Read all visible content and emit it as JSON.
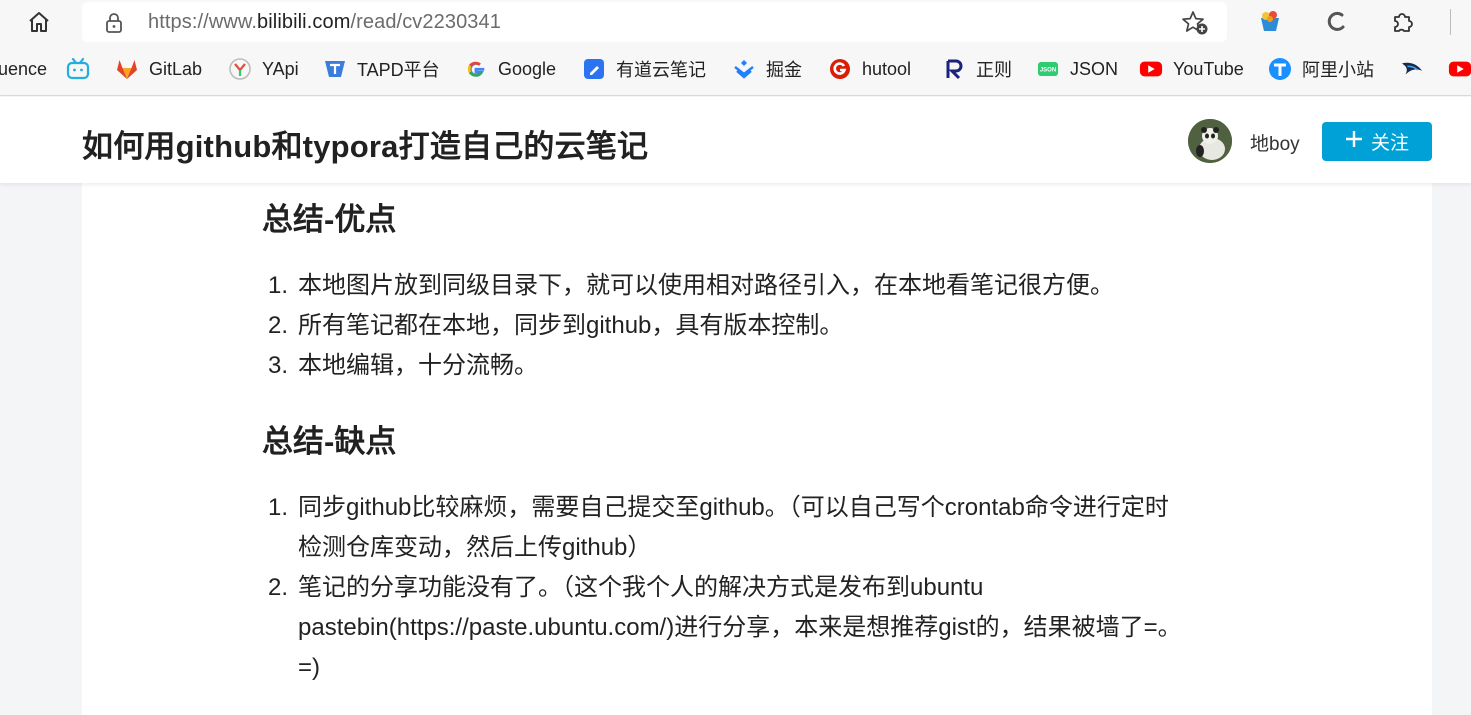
{
  "browser": {
    "url_prefix": "https://www.",
    "url_host": "bilibili.com",
    "url_path": "/read/cv2230341"
  },
  "bookmarks": [
    {
      "label": "uence",
      "icon": "confluence-icon"
    },
    {
      "label": "",
      "icon": "bilibili-tv-icon"
    },
    {
      "label": "GitLab",
      "icon": "gitlab-icon"
    },
    {
      "label": "YApi",
      "icon": "yapi-icon"
    },
    {
      "label": "TAPD平台",
      "icon": "tapd-icon"
    },
    {
      "label": "Google",
      "icon": "google-icon"
    },
    {
      "label": "有道云笔记",
      "icon": "youdao-note-icon"
    },
    {
      "label": "掘金",
      "icon": "juejin-icon"
    },
    {
      "label": "hutool",
      "icon": "hutool-icon"
    },
    {
      "label": "正则",
      "icon": "regex-icon"
    },
    {
      "label": "JSON",
      "icon": "json-icon"
    },
    {
      "label": "YouTube",
      "icon": "youtube-icon"
    },
    {
      "label": "阿里小站",
      "icon": "aliyun-icon"
    },
    {
      "label": "",
      "icon": "bird-icon"
    },
    {
      "label": "",
      "icon": "youtube-icon"
    }
  ],
  "header": {
    "title": "如何用github和typora打造自己的云笔记",
    "author": "地boy",
    "follow_label": "关注"
  },
  "article": {
    "sections": [
      {
        "heading": "总结-优点",
        "items": [
          {
            "num": "1.",
            "lines": [
              "本地图片放到同级目录下，就可以使用相对路径引入，在本地看笔记很方便。"
            ]
          },
          {
            "num": "2.",
            "lines": [
              "所有笔记都在本地，同步到github，具有版本控制。"
            ]
          },
          {
            "num": "3.",
            "lines": [
              "本地编辑，十分流畅。"
            ]
          }
        ]
      },
      {
        "heading": "总结-缺点",
        "items": [
          {
            "num": "1.",
            "lines": [
              "同步github比较麻烦，需要自己提交至github。（可以自己写个crontab命令进行定时",
              "检测仓库变动，然后上传github）"
            ]
          },
          {
            "num": "2.",
            "lines": [
              "笔记的分享功能没有了。（这个我个人的解决方式是发布到ubuntu",
              "pastebin(https://paste.ubuntu.com/)进行分享，本来是想推荐gist的，结果被墙了=。",
              "=)"
            ]
          }
        ]
      }
    ]
  },
  "colors": {
    "accent": "#00a1d6",
    "header_bg": "#ffffff",
    "page_bg": "#f4f5f7",
    "chrome_bg": "#f7f7f7"
  }
}
